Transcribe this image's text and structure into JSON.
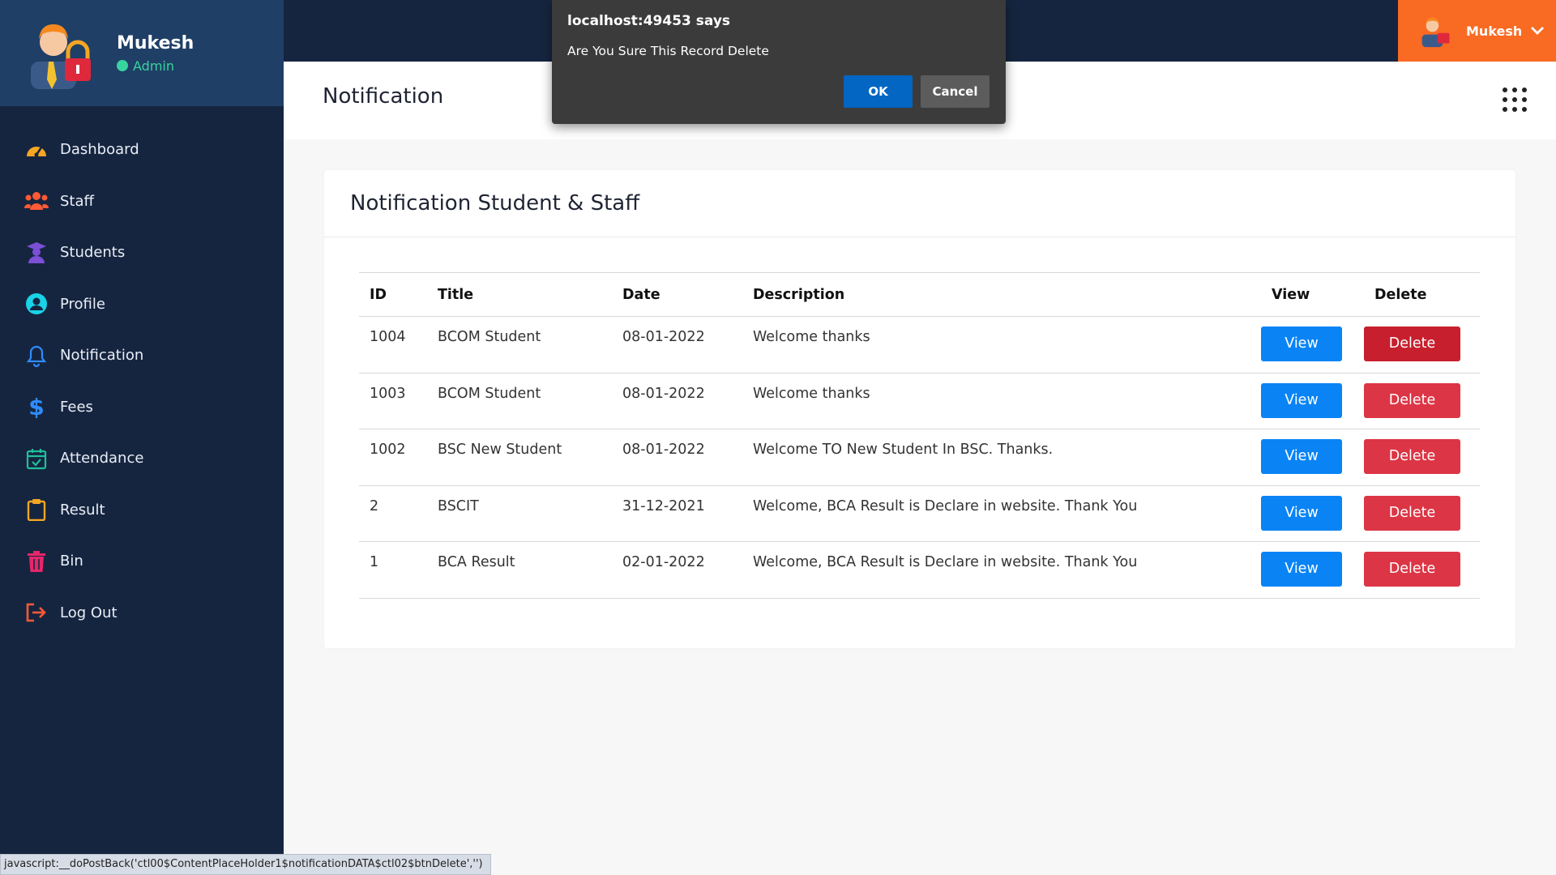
{
  "sidebar": {
    "profile": {
      "name": "Mukesh",
      "role": "Admin"
    },
    "items": [
      {
        "label": "Dashboard",
        "icon": "dashboard-gauge-icon",
        "color": "#f5a623"
      },
      {
        "label": "Staff",
        "icon": "users-icon",
        "color": "#ff5a36"
      },
      {
        "label": "Students",
        "icon": "graduate-icon",
        "color": "#7b4fd6"
      },
      {
        "label": "Profile",
        "icon": "user-circle-icon",
        "color": "#19d3e8"
      },
      {
        "label": "Notification",
        "icon": "bell-icon",
        "color": "#2f8cff"
      },
      {
        "label": "Fees",
        "icon": "dollar-icon",
        "color": "#2f8cff"
      },
      {
        "label": "Attendance",
        "icon": "calendar-check-icon",
        "color": "#1fbf9a"
      },
      {
        "label": "Result",
        "icon": "clipboard-icon",
        "color": "#f5a623"
      },
      {
        "label": "Bin",
        "icon": "trash-icon",
        "color": "#e6266a"
      },
      {
        "label": "Log Out",
        "icon": "logout-icon",
        "color": "#ff5a36"
      }
    ]
  },
  "topbar": {
    "user_name": "Mukesh"
  },
  "header": {
    "title": "Notification"
  },
  "card": {
    "title": "Notification Student & Staff",
    "columns": [
      "ID",
      "Title",
      "Date",
      "Description",
      "View",
      "Delete"
    ],
    "view_label": "View",
    "delete_label": "Delete",
    "rows": [
      {
        "id": "1004",
        "title": "BCOM Student",
        "date": "08-01-2022",
        "description": "Welcome thanks"
      },
      {
        "id": "1003",
        "title": "BCOM Student",
        "date": "08-01-2022",
        "description": "Welcome thanks"
      },
      {
        "id": "1002",
        "title": "BSC New Student",
        "date": "08-01-2022",
        "description": "Welcome TO New Student In BSC. Thanks."
      },
      {
        "id": "2",
        "title": "BSCIT",
        "date": "31-12-2021",
        "description": "Welcome, BCA Result is Declare in website. Thank You"
      },
      {
        "id": "1",
        "title": "BCA Result",
        "date": "02-01-2022",
        "description": "Welcome, BCA Result is Declare in website. Thank You"
      }
    ]
  },
  "dialog": {
    "title": "localhost:49453 says",
    "message": "Are You Sure This Record Delete",
    "ok_label": "OK",
    "cancel_label": "Cancel"
  },
  "statusbar": {
    "text": "javascript:__doPostBack('ctl00$ContentPlaceHolder1$notificationDATA$ctl02$btnDelete','')"
  },
  "colors": {
    "sidebar_bg": "#16253f",
    "profile_bg": "#1f3f66",
    "accent_orange": "#f96a22",
    "view_blue": "#0a84f5",
    "delete_red": "#dc3545",
    "dialog_bg": "#3b3b3b"
  }
}
